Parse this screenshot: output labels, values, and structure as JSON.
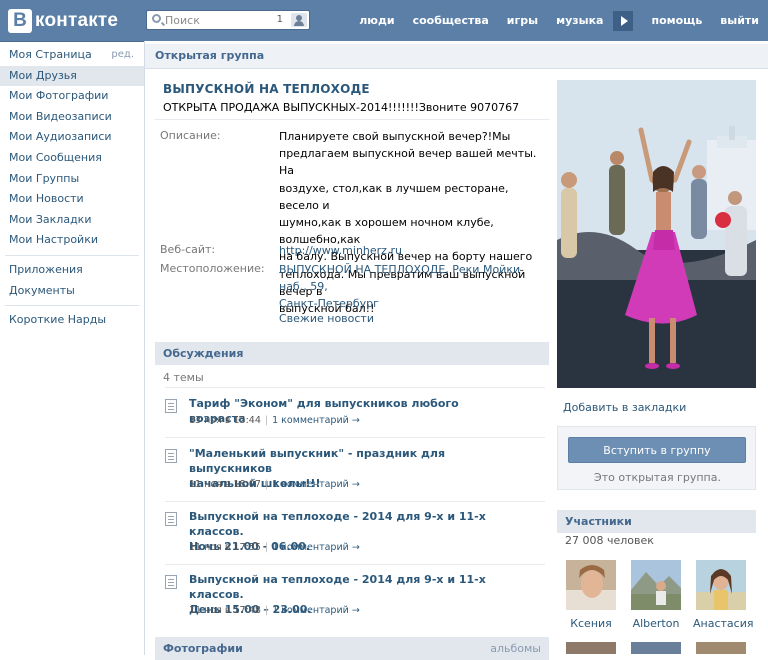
{
  "header": {
    "logo_letter": "В",
    "logo_text": "контакте",
    "search_placeholder": "Поиск",
    "search_count": "1",
    "nav": [
      "люди",
      "сообщества",
      "игры",
      "музыка",
      "помощь",
      "выйти"
    ]
  },
  "sidebar": {
    "edit_label": "ред.",
    "items": [
      {
        "label": "Моя Страница"
      },
      {
        "label": "Мои Друзья"
      },
      {
        "label": "Мои Фотографии"
      },
      {
        "label": "Мои Видеозаписи"
      },
      {
        "label": "Мои Аудиозаписи"
      },
      {
        "label": "Мои Сообщения"
      },
      {
        "label": "Мои Группы"
      },
      {
        "label": "Мои Новости"
      },
      {
        "label": "Мои Закладки"
      },
      {
        "label": "Мои Настройки"
      }
    ],
    "extra": [
      {
        "label": "Приложения"
      },
      {
        "label": "Документы"
      }
    ],
    "apps": [
      {
        "label": "Короткие Нарды"
      }
    ]
  },
  "page": {
    "tab_title": "Открытая группа"
  },
  "group": {
    "name": "ВЫПУСКНОЙ НА ТЕПЛОХОДЕ",
    "status": "ОТКРЫТА ПРОДАЖА ВЫПУСКНЫХ-2014!!!!!!!Звоните 9070767",
    "description_label": "Описание:",
    "description_lines": [
      "Планируете свой выпускной вечер?!Мы",
      "предлагаем выпускной вечер вашей мечты. На",
      "воздухе, стол,как в лучшем ресторане, весело и",
      "шумно,как в хорошем ночном клубе, волшебно,как",
      "на балу. Выпускной вечер на борту нашего",
      "теплохода. Мы превратим ваш выпускной вечер в",
      "выпускной бал!!"
    ],
    "website_label": "Веб-сайт:",
    "website": "http://www.minherz.ru",
    "location_label": "Местоположение:",
    "location_lines": [
      "ВЫПУСКНОЙ НА ТЕПЛОХОДЕ, Реки Мойки наб., 59,",
      "Санкт-Петербург"
    ],
    "news_link": "Свежие новости"
  },
  "discussions": {
    "title": "Обсуждения",
    "count": "4 темы",
    "topics": [
      {
        "title_lines": [
          "Тариф \"Эконом\" для выпускников любого возраста"
        ],
        "date": "13 ноя в 15:44",
        "comments": "1 комментарий →"
      },
      {
        "title_lines": [
          "\"Маленький выпускник\" - праздник для выпускников",
          "начальной школы!!!"
        ],
        "date": "11 ноя в 18:07",
        "comments": "1 комментарий →"
      },
      {
        "title_lines": [
          "Выпускной на теплоходе - 2014 для 9-х и 11-х классов.",
          "Ночь 21.00 - 06.00."
        ],
        "date": "11 ноя в 17:55",
        "comments": "1 комментарий →"
      },
      {
        "title_lines": [
          "Выпускной на теплоходе - 2014 для 9-х и 11-х классов.",
          "День 15.00 – 23.00."
        ],
        "date": "11 ноя в 17:48",
        "comments": "1 комментарий →"
      }
    ]
  },
  "photos": {
    "title": "Фотографии",
    "albums_link": "альбомы"
  },
  "right": {
    "bookmark_link": "Добавить в закладки",
    "join_button": "Вступить в группу",
    "join_note": "Это открытая группа.",
    "members_title": "Участники",
    "members_count": "27 008 человек",
    "members": [
      {
        "name": "Ксения"
      },
      {
        "name": "Alberton"
      },
      {
        "name": "Анастасия"
      }
    ]
  }
}
